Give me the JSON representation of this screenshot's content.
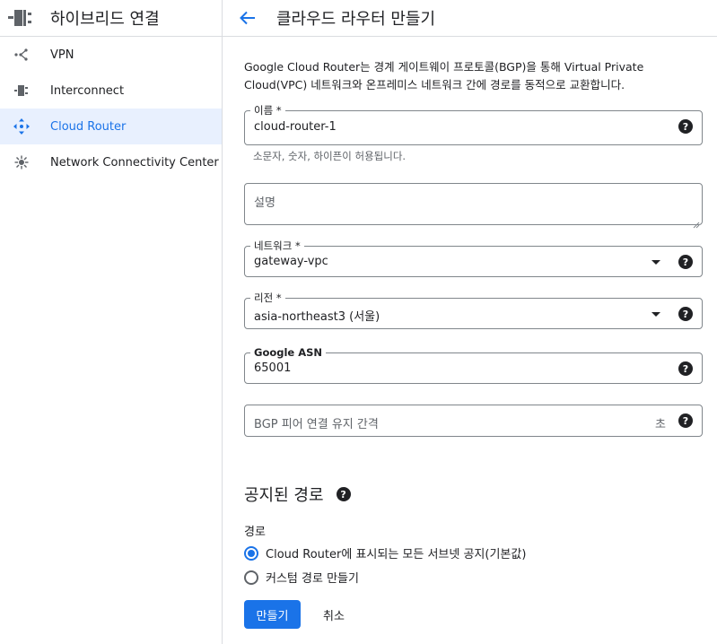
{
  "sidebar": {
    "title": "하이브리드 연결",
    "header_icon": "hybrid-connectivity-icon",
    "items": [
      {
        "label": "VPN",
        "icon": "vpn-icon",
        "active": false
      },
      {
        "label": "Interconnect",
        "icon": "interconnect-icon",
        "active": false
      },
      {
        "label": "Cloud Router",
        "icon": "cloud-router-icon",
        "active": true
      },
      {
        "label": "Network Connectivity Center",
        "icon": "network-connectivity-center-icon",
        "active": false
      }
    ]
  },
  "header": {
    "title": "클라우드 라우터 만들기",
    "back_icon": "arrow-left-icon"
  },
  "form": {
    "description": "Google Cloud Router는 경계 게이트웨이 프로토콜(BGP)을 통해 Virtual Private Cloud(VPC) 네트워크와 온프레미스 네트워크 간에 경로를 동적으로 교환합니다.",
    "name": {
      "label": "이름 *",
      "value": "cloud-router-1",
      "hint": "소문자, 숫자, 하이픈이 허용됩니다."
    },
    "description_field": {
      "placeholder": "설명"
    },
    "network": {
      "label": "네트워크 *",
      "value": "gateway-vpc"
    },
    "region": {
      "label": "리전 *",
      "value": "asia-northeast3 (서울)"
    },
    "asn": {
      "label": "Google ASN",
      "value": "65001"
    },
    "keepalive": {
      "placeholder": "BGP 피어 연결 유지 간격",
      "suffix": "초"
    },
    "help_glyph": "?"
  },
  "advertised": {
    "title": "공지된 경로",
    "routes_label": "경로",
    "options": [
      {
        "label": "Cloud Router에 표시되는 모든 서브넷 공지(기본값)",
        "checked": true
      },
      {
        "label": "커스텀 경로 만들기",
        "checked": false
      }
    ]
  },
  "actions": {
    "create_label": "만들기",
    "cancel_label": "취소"
  },
  "colors": {
    "accent": "#1a73e8",
    "active_bg": "#e8f0fe",
    "border": "#dadce0"
  }
}
